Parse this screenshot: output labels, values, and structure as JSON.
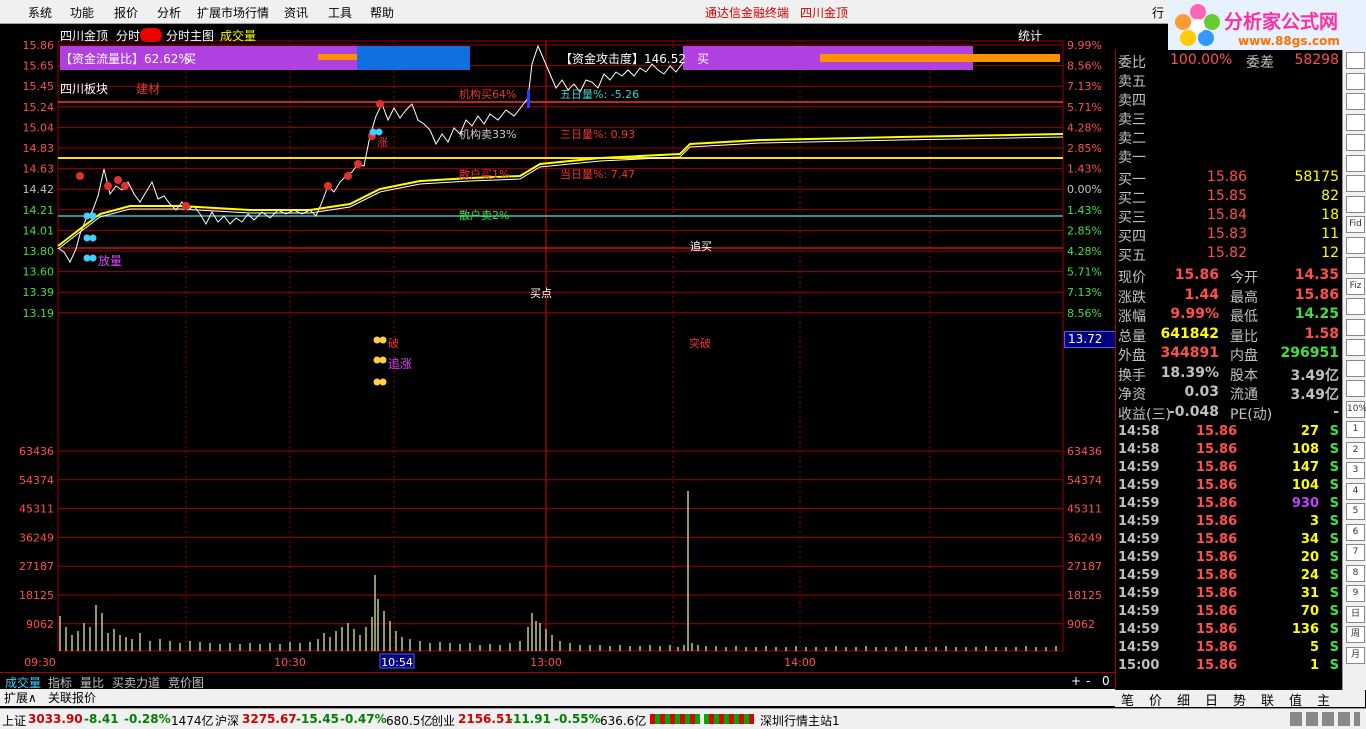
{
  "menu": {
    "items": [
      "系统",
      "功能",
      "报价",
      "分析",
      "扩展市场行情",
      "资讯",
      "工具",
      "帮助"
    ],
    "app_title": "通达信金融终端",
    "stock_title": "四川金顶",
    "corner_btn": "行"
  },
  "logo": {
    "main": "分析家公式网",
    "url": "www.88gs.com"
  },
  "chart": {
    "stock_name": "四川金顶",
    "mode": "分时",
    "main_label": "分时主图",
    "vol_label": "成交量",
    "stat_btn": "统计",
    "sector": "四川板块",
    "sector_sub": "建材",
    "flow_ratio": "【资金流量比】62.62%",
    "flow_ratio_tag": "买",
    "attack": "【资金攻击度】146.52",
    "attack_tag": "买",
    "inst_buy": "机构买64%",
    "inst_sell": "机构卖33%",
    "retail_buy": "散户买1%",
    "retail_sell": "散户卖2%",
    "five_day": "五日量%: -5.26",
    "three_day": "三日量%: 0.93",
    "today": "当日量%: 7.47",
    "chase_buy": "追买",
    "buy_point": "买点",
    "breakout": "突破",
    "vol_up": "放量",
    "chase_up": "追涨",
    "po": "破",
    "zhang": "涨",
    "current_price_box": "13.72",
    "price_ticks": [
      "15.86",
      "15.65",
      "15.45",
      "15.24",
      "15.04",
      "14.83",
      "14.63",
      "14.42",
      "14.21",
      "14.01",
      "13.80",
      "13.60",
      "13.39",
      "13.19"
    ],
    "pct_ticks": [
      "9.99%",
      "8.56%",
      "7.13%",
      "5.71%",
      "4.28%",
      "2.85%",
      "1.43%",
      "0.00%",
      "1.43%",
      "2.85%",
      "4.28%",
      "5.71%",
      "7.13%",
      "8.56%"
    ],
    "vol_ticks": [
      "63436",
      "54374",
      "45311",
      "36249",
      "27187",
      "18125",
      "9062"
    ],
    "time_ticks": [
      "09:30",
      "10:30",
      "10:54",
      "13:00",
      "14:00"
    ],
    "colors": {
      "grid": "#a00000",
      "price_line": "#ffffff",
      "avg_line": "#ffff00",
      "vol": "#c8c880",
      "ref_line": "#ffe000",
      "cyan_line": "#40c0c0"
    }
  },
  "quote": {
    "weibi_label": "委比",
    "weibi": "100.00%",
    "weicha_label": "委差",
    "weicha": "58298",
    "asks": [
      {
        "label": "卖五",
        "price": "",
        "vol": ""
      },
      {
        "label": "卖四",
        "price": "",
        "vol": ""
      },
      {
        "label": "卖三",
        "price": "",
        "vol": ""
      },
      {
        "label": "卖二",
        "price": "",
        "vol": ""
      },
      {
        "label": "卖一",
        "price": "",
        "vol": ""
      }
    ],
    "bids": [
      {
        "label": "买一",
        "price": "15.86",
        "vol": "58175"
      },
      {
        "label": "买二",
        "price": "15.85",
        "vol": "82"
      },
      {
        "label": "买三",
        "price": "15.84",
        "vol": "18"
      },
      {
        "label": "买四",
        "price": "15.83",
        "vol": "11"
      },
      {
        "label": "买五",
        "price": "15.82",
        "vol": "12"
      }
    ],
    "stats": [
      {
        "l1": "现价",
        "v1": "15.86",
        "l2": "今开",
        "v2": "14.35"
      },
      {
        "l1": "涨跌",
        "v1": "1.44",
        "l2": "最高",
        "v2": "15.86"
      },
      {
        "l1": "涨幅",
        "v1": "9.99%",
        "l2": "最低",
        "v2": "14.25"
      },
      {
        "l1": "总量",
        "v1": "641842",
        "l2": "量比",
        "v2": "1.58"
      },
      {
        "l1": "外盘",
        "v1": "344891",
        "l2": "内盘",
        "v2": "296951"
      },
      {
        "l1": "换手",
        "v1": "18.39%",
        "l2": "股本",
        "v2": "3.49亿"
      },
      {
        "l1": "净资",
        "v1": "0.03",
        "l2": "流通",
        "v2": "3.49亿"
      },
      {
        "l1": "收益(三)",
        "v1": "-0.048",
        "l2": "PE(动)",
        "v2": "-"
      }
    ]
  },
  "ticks": [
    {
      "time": "14:58",
      "price": "15.86",
      "vol": "27",
      "side": "S"
    },
    {
      "time": "14:58",
      "price": "15.86",
      "vol": "108",
      "side": "S"
    },
    {
      "time": "14:59",
      "price": "15.86",
      "vol": "147",
      "side": "S"
    },
    {
      "time": "14:59",
      "price": "15.86",
      "vol": "104",
      "side": "S"
    },
    {
      "time": "14:59",
      "price": "15.86",
      "vol": "930",
      "side": "S"
    },
    {
      "time": "14:59",
      "price": "15.86",
      "vol": "3",
      "side": "S"
    },
    {
      "time": "14:59",
      "price": "15.86",
      "vol": "34",
      "side": "S"
    },
    {
      "time": "14:59",
      "price": "15.86",
      "vol": "20",
      "side": "S"
    },
    {
      "time": "14:59",
      "price": "15.86",
      "vol": "24",
      "side": "S"
    },
    {
      "time": "14:59",
      "price": "15.86",
      "vol": "31",
      "side": "S"
    },
    {
      "time": "14:59",
      "price": "15.86",
      "vol": "70",
      "side": "S"
    },
    {
      "time": "14:59",
      "price": "15.86",
      "vol": "136",
      "side": "S"
    },
    {
      "time": "14:59",
      "price": "15.86",
      "vol": "5",
      "side": "S"
    },
    {
      "time": "15:00",
      "price": "15.86",
      "vol": "1",
      "side": "S"
    }
  ],
  "toolstrip": [
    "Fid",
    "Fiz",
    "10%",
    "1",
    "2",
    "3",
    "4",
    "5",
    "6",
    "7",
    "8",
    "9",
    "日",
    "周",
    "月"
  ],
  "tabs": [
    "成交量",
    "指标",
    "量比",
    "买卖力道",
    "竞价图"
  ],
  "tab_controls": [
    "+",
    "-",
    "0"
  ],
  "subtabs": [
    "扩展∧",
    "关联报价"
  ],
  "sidetabs": [
    "笔",
    "价",
    "细",
    "日",
    "势",
    "联",
    "值",
    "主"
  ],
  "status": {
    "sh_label": "上证",
    "sh_val": "3033.90",
    "sh_chg": "-8.41",
    "sh_pct": "-0.28%",
    "sh_amt": "1474亿",
    "hs_label": "沪深",
    "hs_val": "3275.67",
    "hs_chg": "-15.45",
    "hs_pct": "-0.47%",
    "hs_amt": "680.5亿",
    "cy_label": "创业",
    "cy_val": "2156.51",
    "cy_chg": "-11.91",
    "cy_pct": "-0.55%",
    "cy_amt": "636.6亿",
    "server": "深圳行情主站1"
  }
}
